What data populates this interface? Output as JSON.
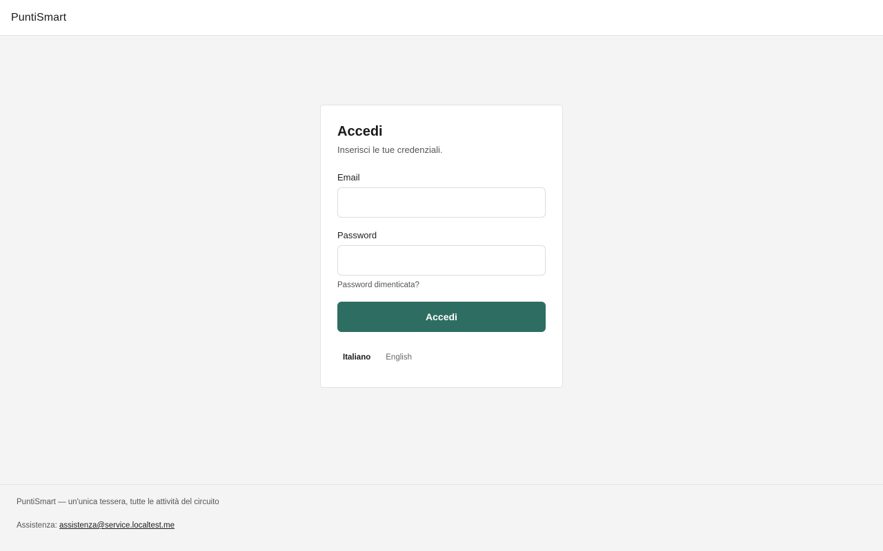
{
  "header": {
    "brand": "PuntiSmart"
  },
  "login": {
    "title": "Accedi",
    "subtitle": "Inserisci le tue credenziali.",
    "email_label": "Email",
    "email_value": "",
    "password_label": "Password",
    "password_value": "",
    "forgot_link": "Password dimenticata?",
    "submit_label": "Accedi",
    "accent_color": "#2e6e62"
  },
  "language": {
    "options": [
      {
        "label": "Italiano",
        "active": true
      },
      {
        "label": "English",
        "active": false
      }
    ]
  },
  "footer": {
    "tagline": "PuntiSmart — un'unica tessera, tutte le attività del circuito",
    "support_prefix": "Assistenza:",
    "support_email": "assistenza@service.localtest.me"
  }
}
